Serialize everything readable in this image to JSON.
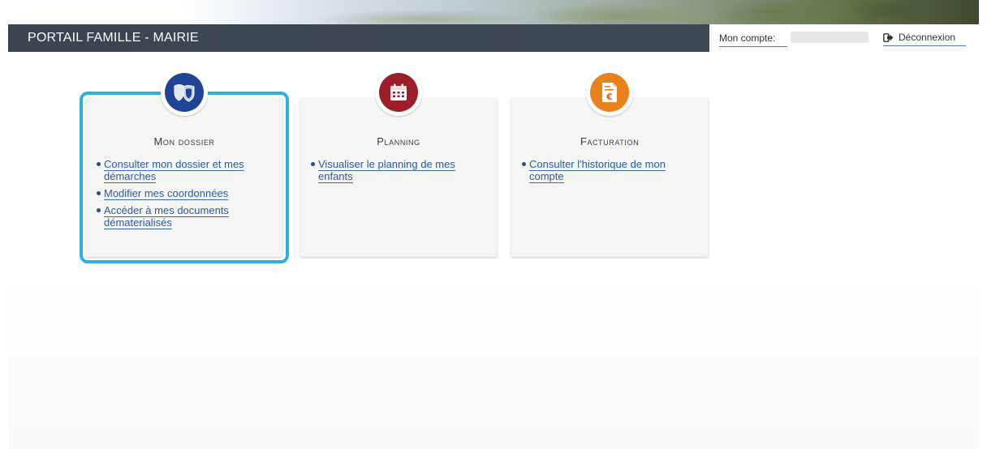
{
  "header": {
    "title": "PORTAIL FAMILLE - MAIRIE",
    "account_label": "Mon compte:",
    "logout_label": "Déconnexion"
  },
  "colors": {
    "header_bg": "#3b4450",
    "selected_outline": "#2bb0e2",
    "link": "#2b5aa0",
    "dossier_icon": "#1f4496",
    "planning_icon": "#9b1e2a",
    "facturation_icon": "#e8821a"
  },
  "cards": [
    {
      "icon": "shield-pair-icon",
      "title": "Mon dossier",
      "selected": true,
      "links": [
        "Consulter mon dossier et mes démarches",
        "Modifier mes coordonnées",
        "Accéder à mes documents dématerialisés"
      ]
    },
    {
      "icon": "calendar-icon",
      "title": "Planning",
      "selected": false,
      "links": [
        "Visualiser le planning de mes enfants"
      ]
    },
    {
      "icon": "invoice-euro-icon",
      "title": "Facturation",
      "selected": false,
      "links": [
        "Consulter l'historique de mon compte"
      ]
    }
  ]
}
